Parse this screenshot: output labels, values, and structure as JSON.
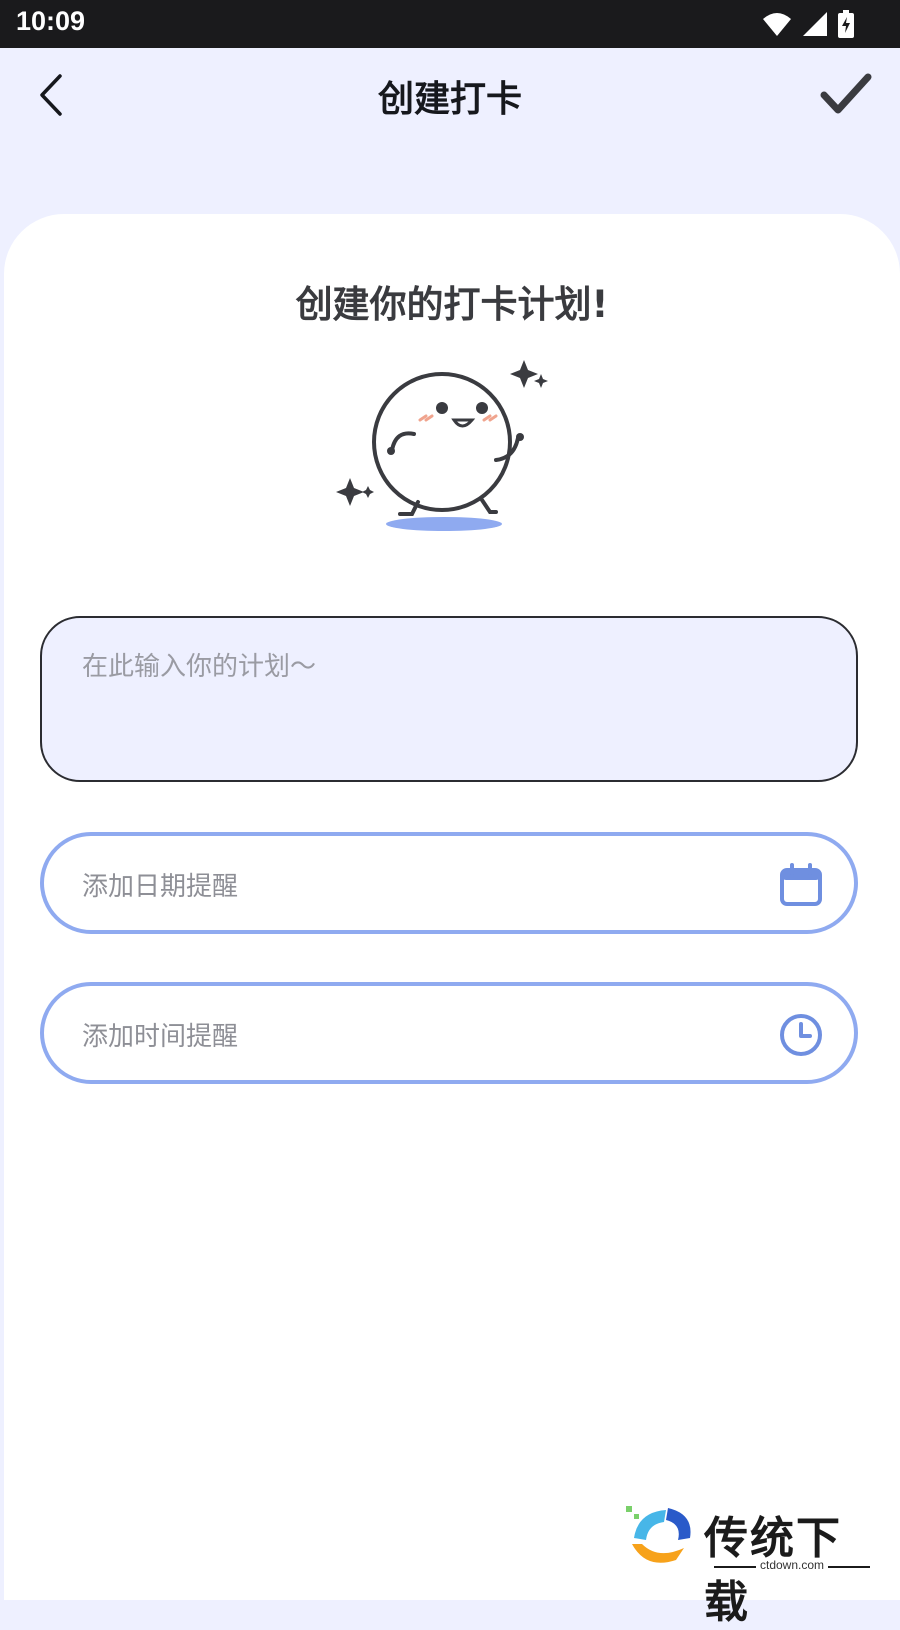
{
  "status_bar": {
    "time": "10:09"
  },
  "app_bar": {
    "title": "创建打卡",
    "back_icon": "chevron-left-icon",
    "confirm_icon": "check-icon"
  },
  "main": {
    "headline": "创建你的打卡计划!",
    "plan_placeholder": "在此输入你的计划～",
    "date_reminder_label": "添加日期提醒",
    "time_reminder_label": "添加时间提醒"
  },
  "watermark": {
    "name": "传统下载",
    "domain": "ctdown.com"
  },
  "colors": {
    "background": "#eef0ff",
    "accent_border": "#8faaf0",
    "icon_blue": "#6f8fe0",
    "text_dark": "#16181d"
  }
}
